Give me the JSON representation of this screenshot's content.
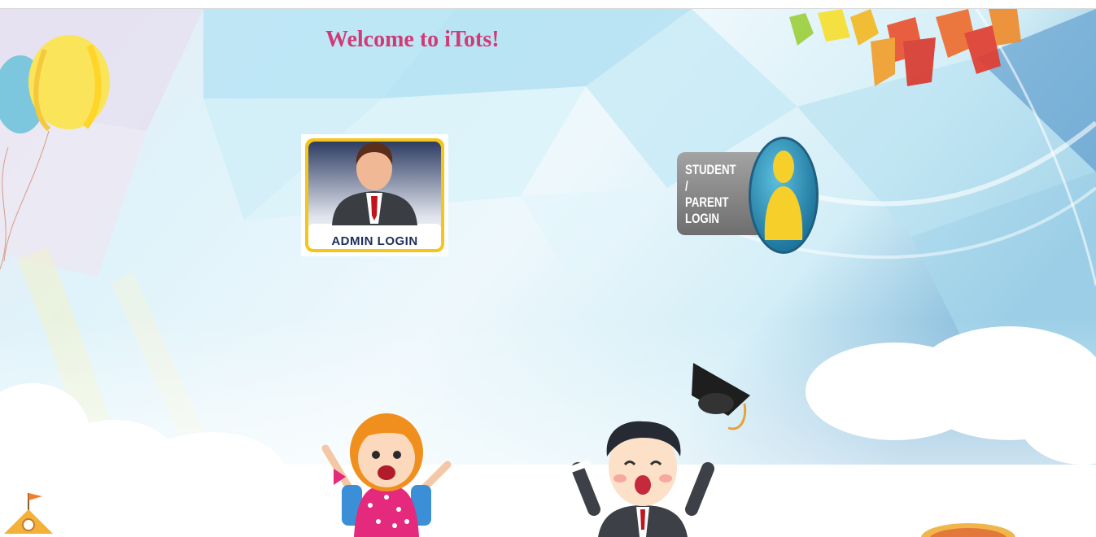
{
  "page": {
    "title": "Welcome to iTots!"
  },
  "logins": {
    "admin": {
      "label": "ADMIN LOGIN"
    },
    "student_parent": {
      "label": "STUDENT /\nPARENT\nLOGIN"
    }
  },
  "colors": {
    "title": "#d03b77",
    "admin_frame": "#f5c518",
    "admin_text": "#1c2e5c",
    "student_badge": "#8a8a8a",
    "student_circle": "#2a8fb5",
    "student_figure": "#f6cf2a",
    "sky_light": "#c9ecf7",
    "sky_mid": "#8fd1ea"
  },
  "icons": {
    "admin": "businessman-icon",
    "student_parent": "person-silhouette-icon",
    "balloons": "balloons-icon",
    "leaves": "autumn-leaves-icon",
    "girl": "cartoon-girl-icon",
    "graduate": "cartoon-graduate-icon",
    "grad_cap": "graduation-cap-icon",
    "school": "school-house-icon"
  }
}
